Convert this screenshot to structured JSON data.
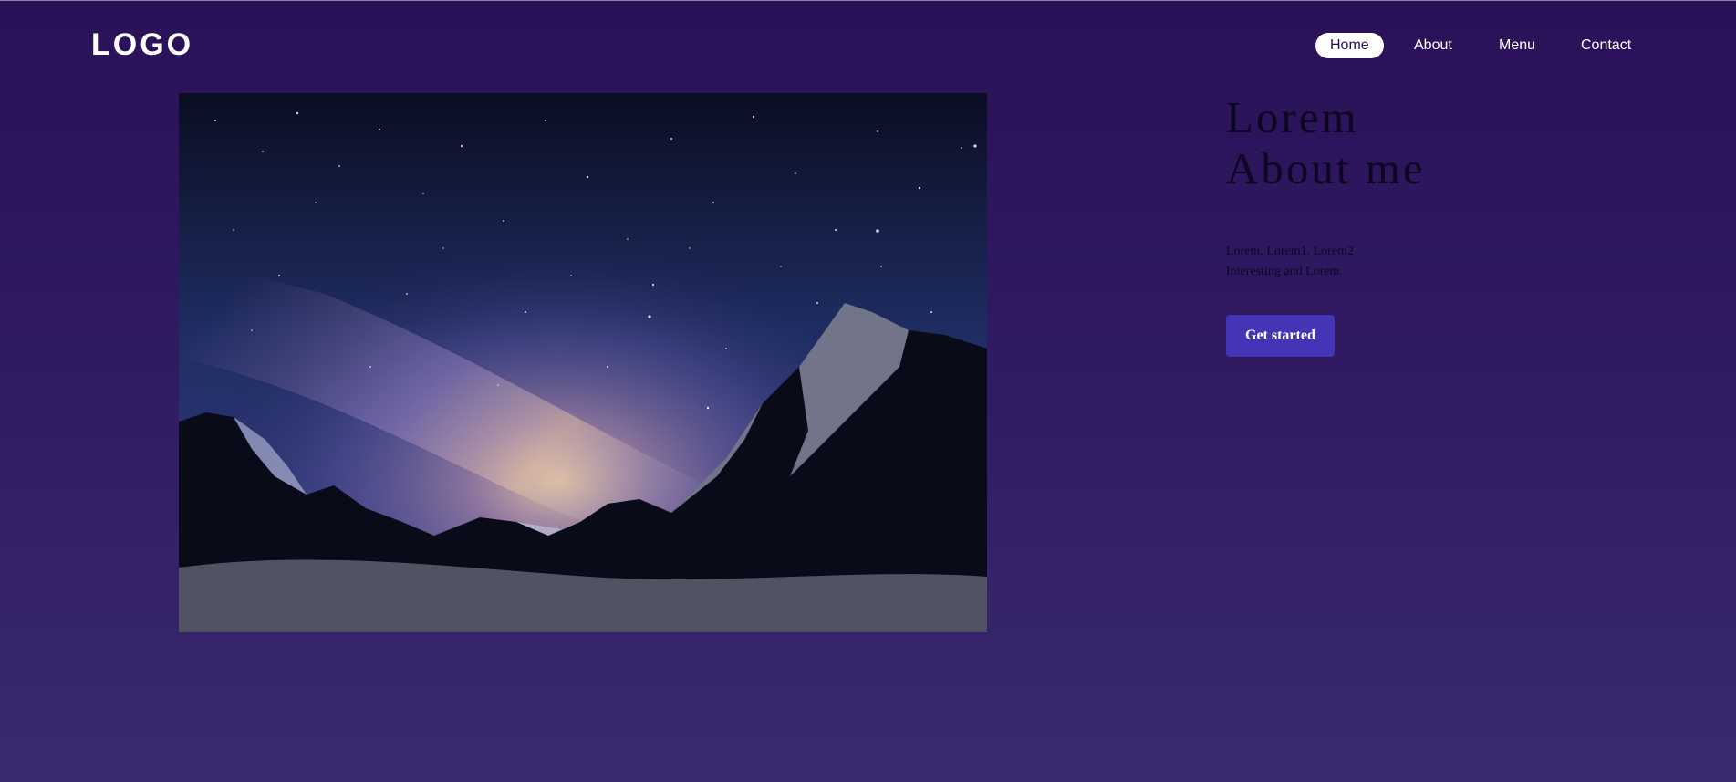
{
  "header": {
    "logo": "LOGO",
    "nav": [
      "Home",
      "About",
      "Menu",
      "Contact"
    ]
  },
  "hero": {
    "title_line1": "Lorem",
    "title_line2": "About me",
    "desc_line1": "Lorem, Lorem1, Lorem2",
    "desc_line2": "Interesting and Lorem.",
    "cta_label": "Get started"
  },
  "colors": {
    "background_top": "#2a1158",
    "background_bottom": "#3a2a6f",
    "accent": "#4435b6",
    "nav_active_bg": "#ffffff"
  }
}
